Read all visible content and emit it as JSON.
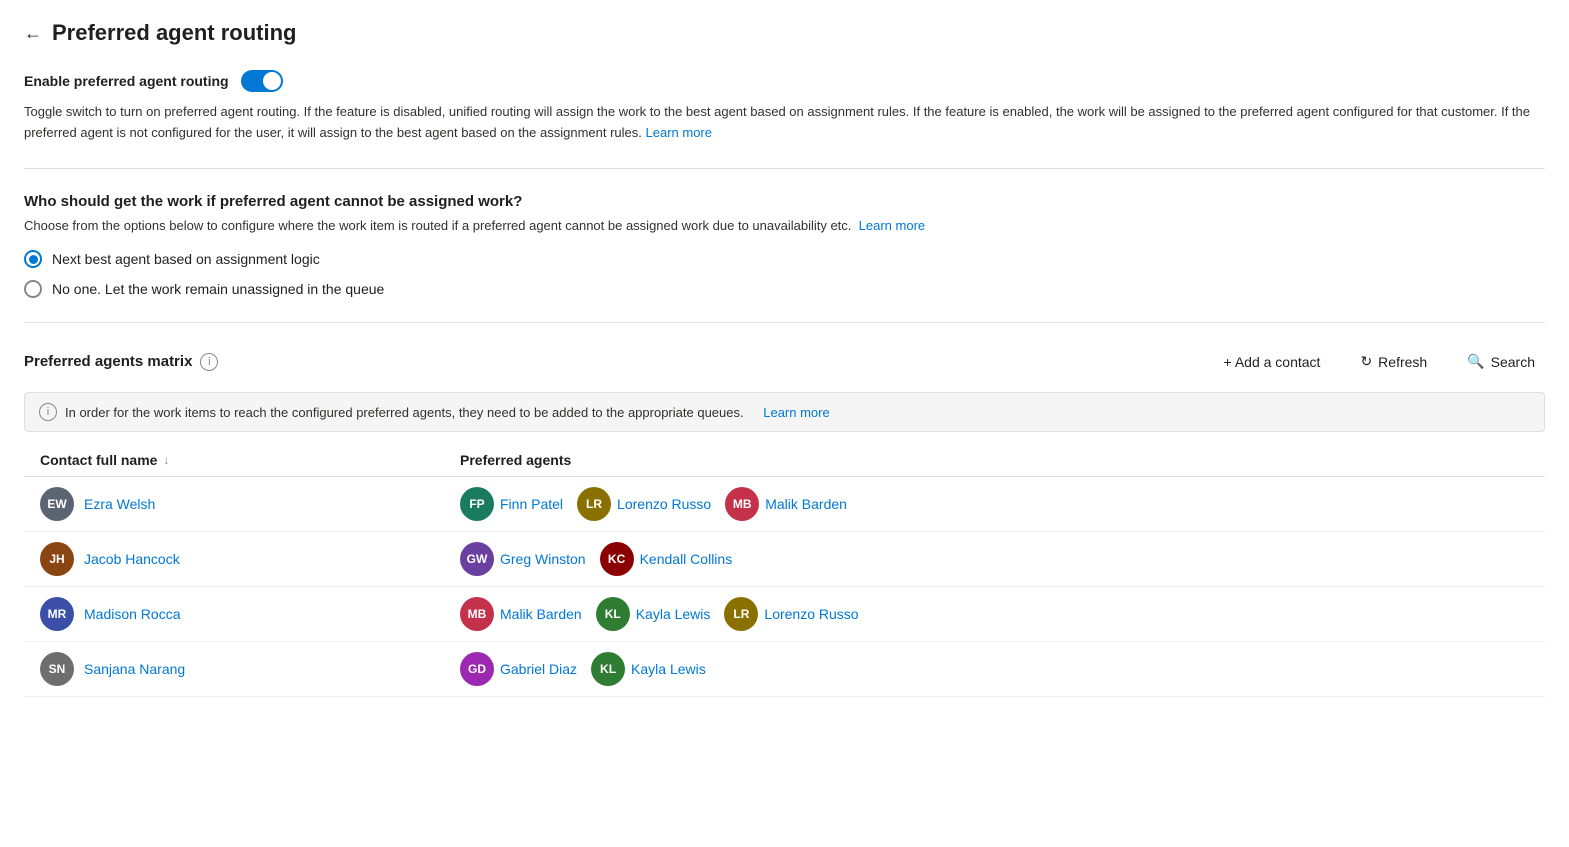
{
  "page": {
    "title": "Preferred agent routing",
    "back_label": "←"
  },
  "enable_section": {
    "label": "Enable preferred agent routing",
    "description": "Toggle switch to turn on preferred agent routing. If the feature is disabled, unified routing will assign the work to the best agent based on assignment rules. If the feature is enabled, the work will be assigned to the preferred agent configured for that customer. If the preferred agent is not configured for the user, it will assign to the best agent based on the assignment rules.",
    "learn_more": "Learn more",
    "toggle_on": true
  },
  "routing_section": {
    "heading": "Who should get the work if preferred agent cannot be assigned work?",
    "description": "Choose from the options below to configure where the work item is routed if a preferred agent cannot be assigned work due to unavailability etc.",
    "learn_more": "Learn more",
    "options": [
      {
        "id": "opt1",
        "label": "Next best agent based on assignment logic",
        "selected": true
      },
      {
        "id": "opt2",
        "label": "No one. Let the work remain unassigned in the queue",
        "selected": false
      }
    ]
  },
  "matrix_section": {
    "title": "Preferred agents matrix",
    "info_icon": "i",
    "add_contact_label": "+ Add a contact",
    "refresh_label": "Refresh",
    "search_label": "Search",
    "info_banner": "In order for the work items to reach the configured preferred agents, they need to be added to the appropriate queues.",
    "info_banner_learn_more": "Learn more",
    "table": {
      "col_contact": "Contact full name",
      "col_agents": "Preferred agents",
      "rows": [
        {
          "contact": {
            "name": "Ezra Welsh",
            "initials": "EW",
            "color": "#5a6472"
          },
          "agents": [
            {
              "name": "Finn Patel",
              "initials": "FP",
              "color": "#1a7b5e"
            },
            {
              "name": "Lorenzo Russo",
              "initials": "LR",
              "color": "#8a7000"
            },
            {
              "name": "Malik Barden",
              "initials": "MB",
              "color": "#c4314b"
            }
          ]
        },
        {
          "contact": {
            "name": "Jacob Hancock",
            "initials": "JH",
            "color": "#8b4513"
          },
          "agents": [
            {
              "name": "Greg Winston",
              "initials": "GW",
              "color": "#6b3fa0"
            },
            {
              "name": "Kendall Collins",
              "initials": "KC",
              "color": "#8b0000"
            }
          ]
        },
        {
          "contact": {
            "name": "Madison Rocca",
            "initials": "MR",
            "color": "#3b4fa8"
          },
          "agents": [
            {
              "name": "Malik Barden",
              "initials": "MB",
              "color": "#c4314b"
            },
            {
              "name": "Kayla Lewis",
              "initials": "KL",
              "color": "#2e7d32"
            },
            {
              "name": "Lorenzo Russo",
              "initials": "LR",
              "color": "#8a7000"
            }
          ]
        },
        {
          "contact": {
            "name": "Sanjana Narang",
            "initials": "SN",
            "color": "#6e6e6e"
          },
          "agents": [
            {
              "name": "Gabriel Diaz",
              "initials": "GD",
              "color": "#9c27b0"
            },
            {
              "name": "Kayla Lewis",
              "initials": "KL",
              "color": "#2e7d32"
            }
          ]
        }
      ]
    }
  }
}
